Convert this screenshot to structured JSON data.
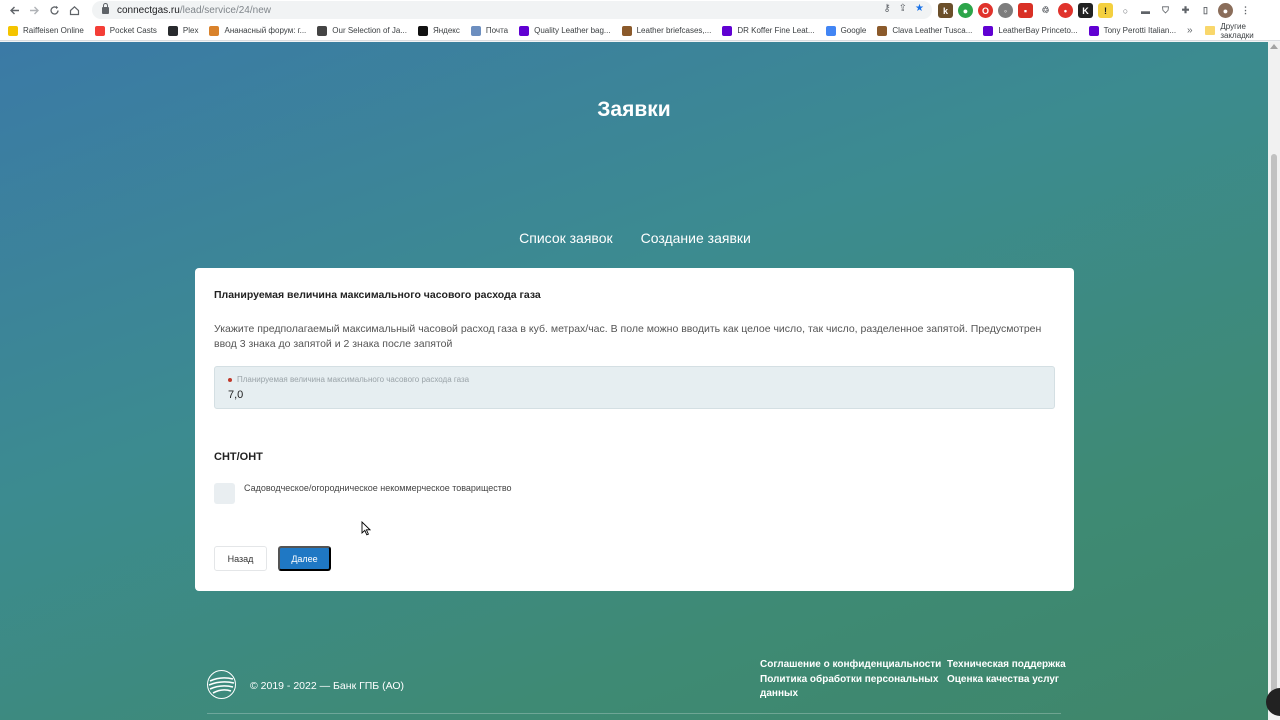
{
  "browser": {
    "url_host": "connectgas.ru",
    "url_path": "/lead/service/24/new",
    "bookmarks": [
      {
        "label": "Raiffeisen Online",
        "icon": "raiffeisen-icon",
        "color": "#f4c400"
      },
      {
        "label": "Pocket Casts",
        "icon": "pocket-casts-icon",
        "color": "#f43e37"
      },
      {
        "label": "Plex",
        "icon": "plex-icon",
        "color": "#282a2d"
      },
      {
        "label": "Ананасный форум: г...",
        "icon": "pineapple-forum-icon",
        "color": "#d9822b"
      },
      {
        "label": "Our Selection of Ja...",
        "icon": "globe-icon",
        "color": "#444444"
      },
      {
        "label": "Яндекс",
        "icon": "yandex-icon",
        "color": "#111111"
      },
      {
        "label": "Почта",
        "icon": "mail-icon",
        "color": "#6c8ebf"
      },
      {
        "label": "Quality Leather bag...",
        "icon": "yahoo-icon",
        "color": "#6001d2"
      },
      {
        "label": "Leather briefcases,...",
        "icon": "briefcase-icon",
        "color": "#8b5a2b"
      },
      {
        "label": "DR Koffer Fine Leat...",
        "icon": "yahoo-icon",
        "color": "#6001d2"
      },
      {
        "label": "Google",
        "icon": "google-icon",
        "color": "#4285f4"
      },
      {
        "label": "Clava Leather Tusca...",
        "icon": "leather-icon",
        "color": "#8b5a2b"
      },
      {
        "label": "LeatherBay Princeto...",
        "icon": "yahoo-icon",
        "color": "#6001d2"
      },
      {
        "label": "Tony Perotti Italian...",
        "icon": "yahoo-icon",
        "color": "#6001d2"
      }
    ],
    "bookmarks_more": "»",
    "other_bookmarks": "Другие закладки"
  },
  "page": {
    "title": "Заявки",
    "tabs": [
      "Список заявок",
      "Создание заявки"
    ]
  },
  "form": {
    "field_title": "Планируемая величина максимального часового расхода газа",
    "hint": "Укажите предполагаемый максимальный часовой расход газа в куб. метрах/час. В поле можно вводить как целое число, так число, разделенное запятой. Предусмотрен ввод 3 знака до запятой и 2 знака после запятой",
    "input_label": "Планируемая величина максимального часового расхода газа",
    "input_value": "7,0",
    "section_title": "СНТ/ОНТ",
    "checkbox_label": "Садоводческое/огородническое некоммерческое товарищество",
    "checkbox_checked": false,
    "back_label": "Назад",
    "next_label": "Далее",
    "accent_color": "#1f78c4"
  },
  "footer": {
    "copyright": "© 2019 - 2022 — Банк ГПБ (АО)",
    "links_col1": [
      "Соглашение о конфиденциальности",
      "Политика обработки персональных",
      "данных"
    ],
    "links_col2": [
      "Техническая поддержка",
      "Оценка качества услуг"
    ]
  }
}
